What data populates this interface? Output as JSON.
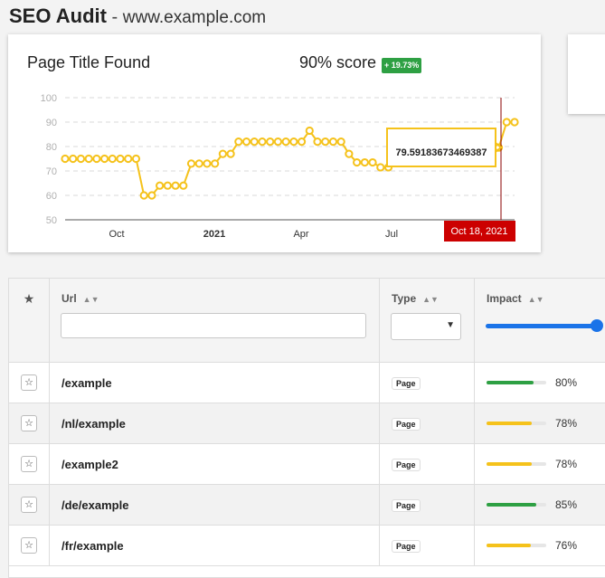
{
  "header": {
    "app_title": "SEO Audit",
    "separator": " - ",
    "site": "www.example.com"
  },
  "card": {
    "title": "Page Title Found",
    "score": "90% score",
    "delta": "+ 19.73%"
  },
  "colors": {
    "line": "#f5c21b",
    "cursor": "#8b0000",
    "cursor_label_bg": "#cc0000",
    "up": "#2ea043",
    "accent": "#1a73e8"
  },
  "chart_data": {
    "type": "line",
    "title": "Page Title Found",
    "ylim": [
      50,
      100
    ],
    "yticks": [
      50,
      60,
      70,
      80,
      90,
      100
    ],
    "xticks": [
      "Oct",
      "2021",
      "Apr",
      "Jul"
    ],
    "grid": true,
    "series": [
      {
        "values": [
          75,
          75,
          75,
          75,
          75,
          75,
          75,
          75,
          75,
          75,
          60,
          60,
          64,
          64,
          64,
          64,
          73,
          73,
          73,
          73,
          77,
          77,
          82,
          82,
          82,
          82,
          82,
          82,
          82,
          82,
          82,
          86.5,
          82,
          82,
          82,
          82,
          77,
          73.5,
          73.5,
          73.5,
          71.5,
          71.5,
          75,
          75,
          77,
          80,
          79.59,
          79.59,
          79.59,
          79.59,
          79.59,
          79.59,
          79.59,
          79.59,
          79.59,
          79.59,
          90,
          90
        ]
      }
    ],
    "tooltip": "79.59183673469387",
    "cursor_label": "Oct 18, 2021"
  },
  "table": {
    "columns": {
      "url": "Url",
      "type": "Type",
      "impact": "Impact"
    },
    "rows": [
      {
        "url": "/example",
        "type": "Page",
        "impact": 80,
        "impact_label": "80%",
        "bar_color": "#2ea043"
      },
      {
        "url": "/nl/example",
        "type": "Page",
        "impact": 78,
        "impact_label": "78%",
        "bar_color": "#f5c21b"
      },
      {
        "url": "/example2",
        "type": "Page",
        "impact": 78,
        "impact_label": "78%",
        "bar_color": "#f5c21b"
      },
      {
        "url": "/de/example",
        "type": "Page",
        "impact": 85,
        "impact_label": "85%",
        "bar_color": "#2ea043"
      },
      {
        "url": "/fr/example",
        "type": "Page",
        "impact": 76,
        "impact_label": "76%",
        "bar_color": "#f5c21b"
      }
    ]
  }
}
